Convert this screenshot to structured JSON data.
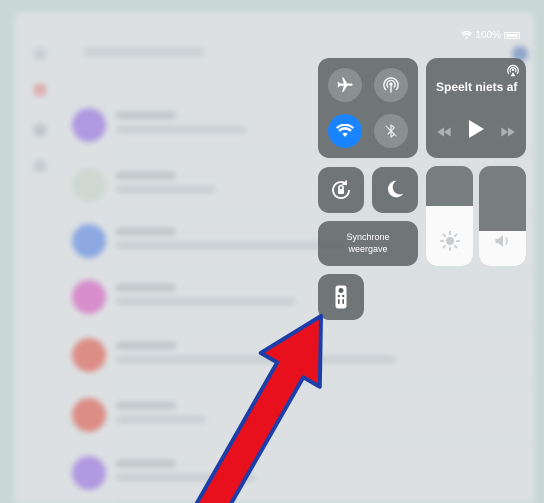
{
  "status_bar": {
    "battery_text": "100%",
    "icons": [
      "wifi-icon",
      "battery-icon"
    ]
  },
  "connectivity": {
    "airplane": {
      "icon": "airplane-icon",
      "active": false
    },
    "airdrop": {
      "icon": "airdrop-icon",
      "active": false
    },
    "wifi": {
      "icon": "wifi-icon",
      "active": true
    },
    "bluetooth": {
      "icon": "bluetooth-icon",
      "active": false
    }
  },
  "media": {
    "title": "Speelt niets af",
    "icons": [
      "airplay-icon",
      "rewind-icon",
      "play-icon",
      "fast-forward-icon"
    ]
  },
  "controls": {
    "rotation_lock_icon": "rotation-lock-icon",
    "do_not_disturb_icon": "moon-icon",
    "screen_mirroring_label_line1": "Synchrone",
    "screen_mirroring_label_line2": "weergave",
    "remote_icon": "apple-tv-remote-icon"
  },
  "sliders": {
    "brightness": {
      "icon": "brightness-icon",
      "level": 0.6
    },
    "volume": {
      "icon": "volume-icon",
      "level": 0.35
    }
  },
  "colors": {
    "accent": "#1a84ff",
    "arrow": "#e8101c",
    "arrow_outline": "#1d3ea8"
  }
}
